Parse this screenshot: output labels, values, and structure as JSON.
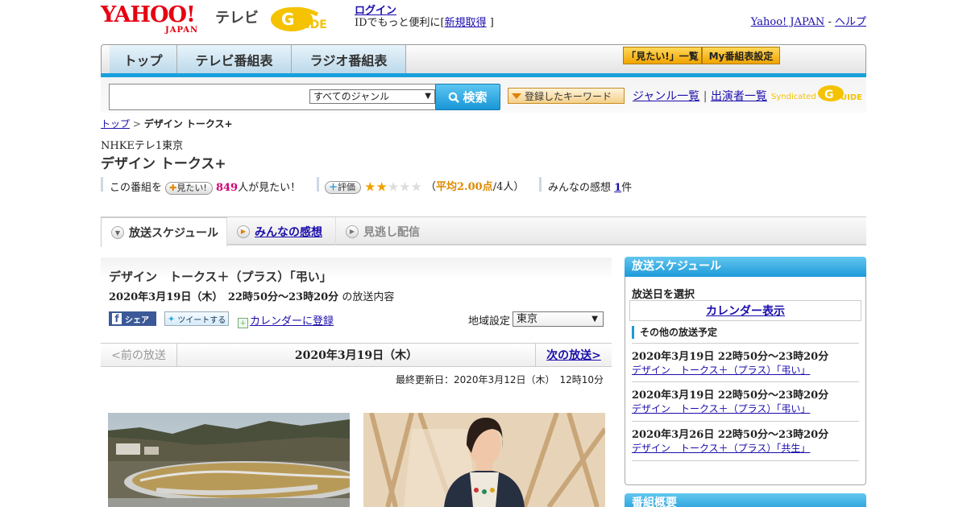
{
  "header": {
    "logo_yahoo": "YAHOO!",
    "logo_japan": "JAPAN",
    "logo_tv": "テレビ",
    "login_label": "ログイン",
    "login_sub_prefix": "IDでもっと便利に[",
    "register_label": "新規取得",
    "login_sub_suffix": "]",
    "yahoo_japan_link": "Yahoo! JAPAN",
    "sep": " - ",
    "help_link": "ヘルプ"
  },
  "nav": {
    "tabs": [
      "トップ",
      "テレビ番組表",
      "ラジオ番組表"
    ],
    "want_list": "「見たい!」一覧",
    "my_schedule": "My番組表設定"
  },
  "search": {
    "genre_selected": "すべてのジャンル",
    "button_label": "検索",
    "keyword_button": "登録したキーワード",
    "genre_list_link": "ジャンル一覧",
    "divider": "|",
    "performer_list_link": "出演者一覧",
    "syndicated": "Syndicated"
  },
  "breadcrumb": {
    "top": "トップ",
    "sep": " > ",
    "current": "デザイン トークス+"
  },
  "program": {
    "channel": "NHKEテレ1東京",
    "title": "デザイン トークス+",
    "want_prefix": "この番組を",
    "want_button": "見たい!",
    "want_count": "849",
    "want_suffix": "人が見たい！",
    "rate_button": "評価",
    "avg_open": "（",
    "avg_label": "平均2.00点",
    "avg_count": "/4人）",
    "rating": 2,
    "rating_max": 5,
    "impressions_prefix": "みんなの感想",
    "impressions_count": "1",
    "impressions_suffix": "件"
  },
  "tabs": {
    "schedule": "放送スケジュール",
    "impressions": "みんなの感想",
    "missed": "見逃し配信"
  },
  "episode": {
    "title": "デザイン　トークス＋（プラス）「弔い」",
    "date_bold": "2020年3月19日（木）　22時50分～23時20分",
    "date_suffix": "の放送内容",
    "share_fb": "シェア",
    "share_tw": "ツイートする",
    "calendar": "カレンダーに登録",
    "region_label": "地域設定",
    "region_value": "東京",
    "prev": "<前の放送",
    "current_date": "2020年3月19日（木）",
    "next": "次の放送>",
    "updated": "最終更新日：2020年3月12日（木）　12時10分"
  },
  "sidebar": {
    "schedule_head": "放送スケジュール",
    "select_label": "放送日を選択",
    "calendar_button": "カレンダー表示",
    "other_label": "その他の放送予定",
    "items": [
      {
        "date": "2020年3月19日  22時50分～23時20分",
        "title": "デザイン　トークス＋（プラス）「弔い」"
      },
      {
        "date": "2020年3月19日  22時50分～23時20分",
        "title": "デザイン　トークス＋（プラス）「弔い」"
      },
      {
        "date": "2020年3月26日  22時50分～23時20分",
        "title": "デザイン　トークス＋（プラス）「共生」"
      }
    ],
    "overview_head": "番組概要"
  },
  "colors": {
    "yahoo_red": "#e60012",
    "accent_blue": "#1d9ad8",
    "link": "#1a0dab",
    "orange": "#e08a00"
  }
}
